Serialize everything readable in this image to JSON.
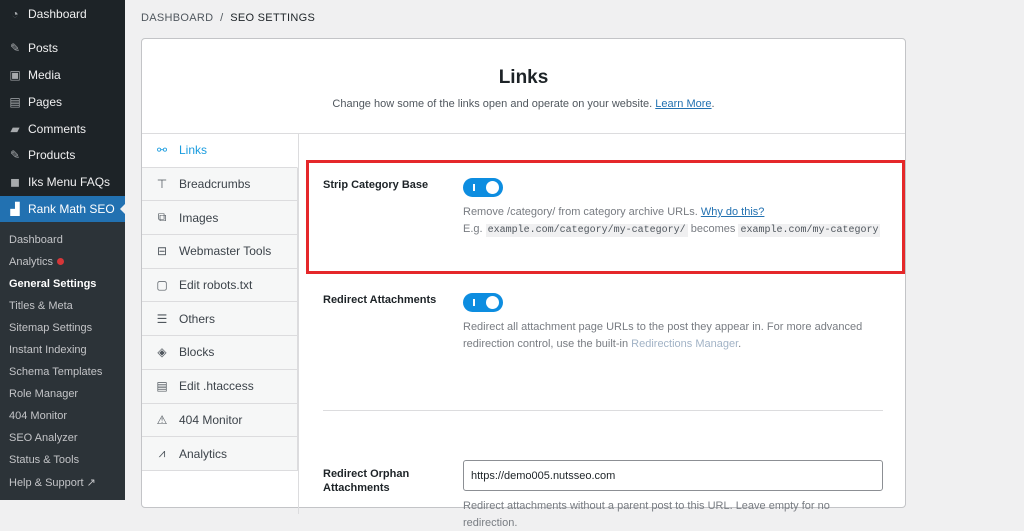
{
  "sidebar": {
    "menu": [
      {
        "label": "Dashboard",
        "icon": "dashboard-icon"
      },
      {
        "label": "Posts",
        "icon": "pin-icon"
      },
      {
        "label": "Media",
        "icon": "media-icon"
      },
      {
        "label": "Pages",
        "icon": "pages-icon"
      },
      {
        "label": "Comments",
        "icon": "comment-icon"
      },
      {
        "label": "Products",
        "icon": "pin-icon"
      },
      {
        "label": "Iks Menu FAQs",
        "icon": "faq-icon"
      },
      {
        "label": "Rank Math SEO",
        "icon": "rank-math-icon"
      }
    ],
    "submenu": [
      "Dashboard",
      "Analytics",
      "General Settings",
      "Titles & Meta",
      "Sitemap Settings",
      "Instant Indexing",
      "Schema Templates",
      "Role Manager",
      "404 Monitor",
      "SEO Analyzer",
      "Status & Tools",
      "Help & Support"
    ]
  },
  "breadcrumb": {
    "root": "DASHBOARD",
    "sep": "/",
    "current": "SEO SETTINGS"
  },
  "header": {
    "title": "Links",
    "desc": "Change how some of the links open and operate on your website.",
    "link": "Learn More",
    "end": "."
  },
  "tabs": [
    "Links",
    "Breadcrumbs",
    "Images",
    "Webmaster Tools",
    "Edit robots.txt",
    "Others",
    "Blocks",
    "Edit .htaccess",
    "404 Monitor",
    "Analytics"
  ],
  "fields": {
    "strip": {
      "label": "Strip Category Base",
      "enabled": true,
      "desc": "Remove /category/ from category archive URLs.",
      "link": "Why do this?",
      "eg": "E.g.",
      "code1": "example.com/category/my-category/",
      "becomes": "becomes",
      "code2": "example.com/my-category"
    },
    "redirect": {
      "label": "Redirect Attachments",
      "enabled": true,
      "desc": "Redirect all attachment page URLs to the post they appear in. For more advanced redirection control, use the built-in",
      "link": "Redirections Manager",
      "end": "."
    },
    "orphan": {
      "label": "Redirect Orphan Attachments",
      "value": "https://demo005.nutsseo.com",
      "desc": "Redirect attachments without a parent post to this URL. Leave empty for no redirection."
    }
  },
  "colors": {
    "accent": "#1a9cdf",
    "highlight": "#e5282a",
    "admin_blue": "#2271b1"
  }
}
